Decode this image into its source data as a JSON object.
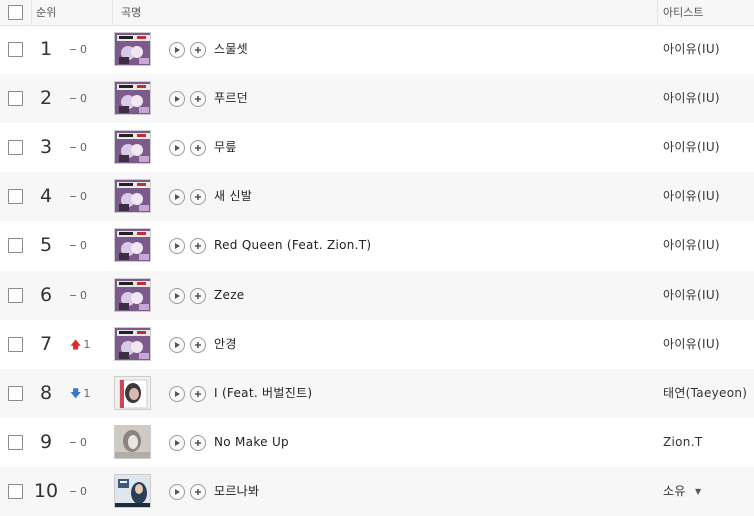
{
  "header": {
    "rank_label": "순위",
    "song_label": "곡명",
    "artist_label": "아티스트"
  },
  "colors": {
    "rise": "#e02a2a",
    "fall": "#3a77c9",
    "row_alt": "#f7f7f7"
  },
  "rows": [
    {
      "rank": "1",
      "change": "0",
      "trend": "same",
      "title": "스물셋",
      "artist": "아이유(IU)",
      "cover": "iu-album-cover"
    },
    {
      "rank": "2",
      "change": "0",
      "trend": "same",
      "title": "푸르던",
      "artist": "아이유(IU)",
      "cover": "iu-album-cover"
    },
    {
      "rank": "3",
      "change": "0",
      "trend": "same",
      "title": "무릎",
      "artist": "아이유(IU)",
      "cover": "iu-album-cover"
    },
    {
      "rank": "4",
      "change": "0",
      "trend": "same",
      "title": "새 신발",
      "artist": "아이유(IU)",
      "cover": "iu-album-cover"
    },
    {
      "rank": "5",
      "change": "0",
      "trend": "same",
      "title": "Red Queen (Feat. Zion.T)",
      "artist": "아이유(IU)",
      "cover": "iu-album-cover"
    },
    {
      "rank": "6",
      "change": "0",
      "trend": "same",
      "title": "Zeze",
      "artist": "아이유(IU)",
      "cover": "iu-album-cover"
    },
    {
      "rank": "7",
      "change": "1",
      "trend": "up",
      "title": "안경",
      "artist": "아이유(IU)",
      "cover": "iu-album-cover"
    },
    {
      "rank": "8",
      "change": "1",
      "trend": "down",
      "title": "I (Feat. 버벌진트)",
      "artist": "태연(Taeyeon)",
      "cover": "taeyeon-album-cover"
    },
    {
      "rank": "9",
      "change": "0",
      "trend": "same",
      "title": "No Make Up",
      "artist": "Zion.T",
      "cover": "zion-album-cover"
    },
    {
      "rank": "10",
      "change": "0",
      "trend": "same",
      "title": "모르나봐",
      "artist": "소유",
      "cover": "soyou-album-cover"
    }
  ]
}
